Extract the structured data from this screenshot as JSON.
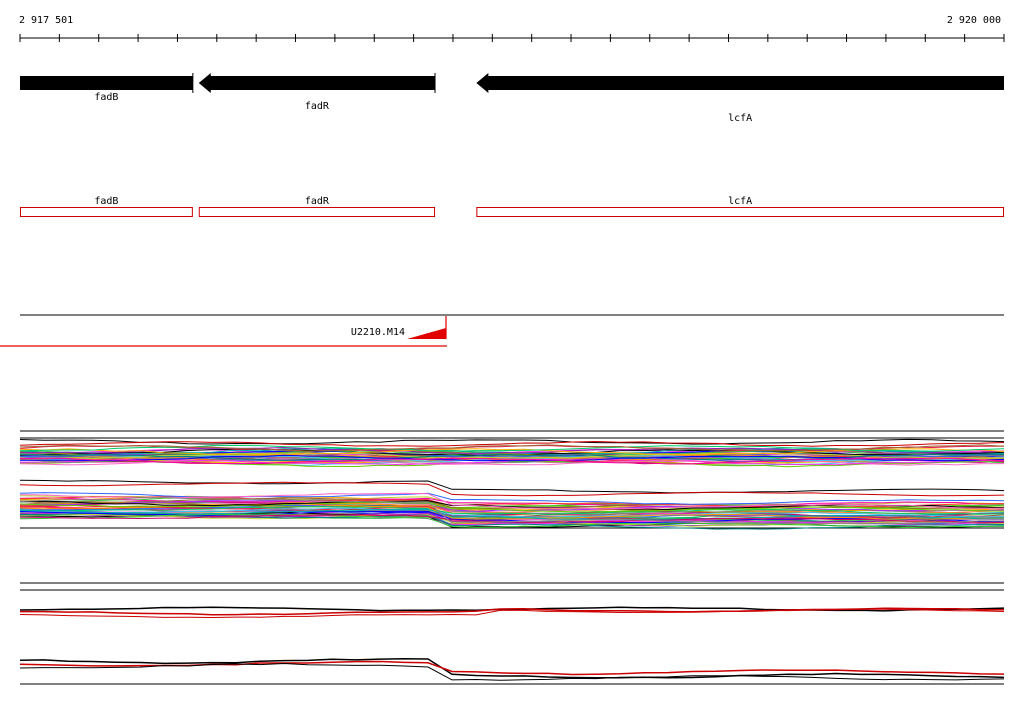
{
  "coordinates": {
    "start_label": "2 917 501",
    "end_label": "2 920 000",
    "start": 2917501,
    "end": 2920000
  },
  "genes": [
    {
      "name": "fadB",
      "start": 2917501,
      "end": 2917940,
      "strand": "+"
    },
    {
      "name": "fadR",
      "start": 2917955,
      "end": 2918555,
      "strand": "-"
    },
    {
      "name": "lcfA",
      "start": 2918660,
      "end": 2920000,
      "strand": "-"
    }
  ],
  "cds_labels": [
    "fadB",
    "fadR",
    "lcfA"
  ],
  "feature": {
    "name": "U2210.M14"
  },
  "colors": {
    "gene": "#000000",
    "cds_outline": "#cc0000",
    "feature": "#e00000",
    "axis": "#000000"
  },
  "palette": [
    "#e6194b",
    "#3cb44b",
    "#4363d8",
    "#f58231",
    "#911eb4",
    "#46c0f0",
    "#f032e6",
    "#bcd62f",
    "#008080",
    "#ffaa00",
    "#0000ff",
    "#ff00aa",
    "#00cc66",
    "#996633",
    "#9933ff",
    "#ff3333",
    "#33cc33",
    "#3366ff",
    "#ff9900",
    "#00aaaa",
    "#cc0066",
    "#66cc00",
    "#000000",
    "#ff66cc",
    "#888888",
    "#aa8800"
  ]
}
